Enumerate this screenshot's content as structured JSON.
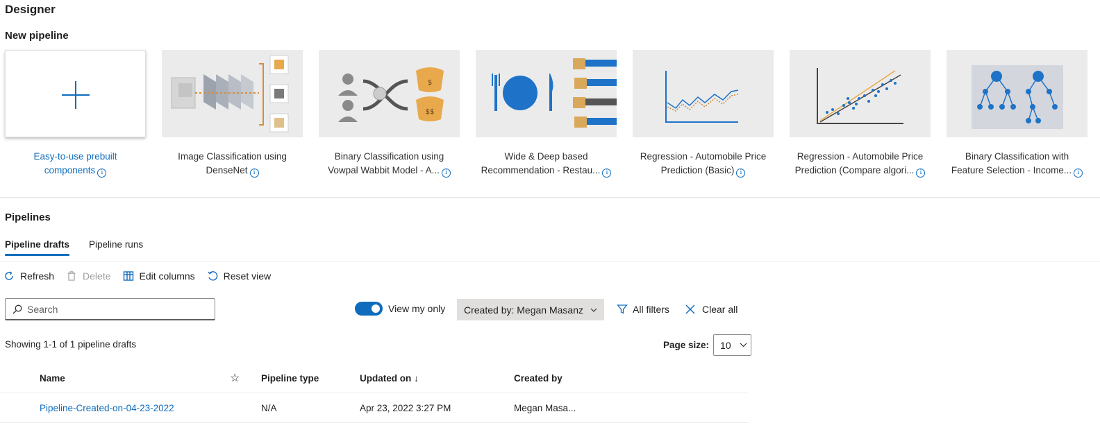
{
  "header": {
    "title": "Designer",
    "new_pipeline_title": "New pipeline"
  },
  "cards": [
    {
      "line1": "Easy-to-use prebuilt",
      "line2": "components",
      "icon": "plus-icon"
    },
    {
      "line1": "Image Classification using",
      "line2": "DenseNet"
    },
    {
      "line1": "Binary Classification using",
      "line2": "Vowpal Wabbit Model - A..."
    },
    {
      "line1": "Wide & Deep based",
      "line2": "Recommendation - Restau..."
    },
    {
      "line1": "Regression - Automobile Price",
      "line2": "Prediction (Basic)"
    },
    {
      "line1": "Regression - Automobile Price",
      "line2": "Prediction (Compare algori..."
    },
    {
      "line1": "Binary Classification with",
      "line2": "Feature Selection - Income..."
    }
  ],
  "pipelines": {
    "title": "Pipelines",
    "tabs": [
      {
        "label": "Pipeline drafts",
        "active": true
      },
      {
        "label": "Pipeline runs",
        "active": false
      }
    ]
  },
  "toolbar": {
    "refresh": "Refresh",
    "delete": "Delete",
    "edit_columns": "Edit columns",
    "reset_view": "Reset view"
  },
  "filters": {
    "search_placeholder": "Search",
    "toggle_label": "View my only",
    "toggle_on": true,
    "created_by": "Created by: Megan Masanz",
    "all_filters": "All filters",
    "clear_all": "Clear all"
  },
  "listing": {
    "showing": "Showing 1-1 of 1 pipeline drafts",
    "page_size_label": "Page size:",
    "page_size_value": "10"
  },
  "table": {
    "columns": {
      "name": "Name",
      "pipeline_type": "Pipeline type",
      "updated_on": "Updated on ↓",
      "created_by": "Created by"
    },
    "rows": [
      {
        "name": "Pipeline-Created-on-04-23-2022",
        "pipeline_type": "N/A",
        "updated_on": "Apr 23, 2022 3:27 PM",
        "created_by": "Megan Masa..."
      }
    ]
  },
  "colors": {
    "accent": "#0f6cbd",
    "orange": "#e8a94c",
    "gray": "#a19f9d"
  }
}
